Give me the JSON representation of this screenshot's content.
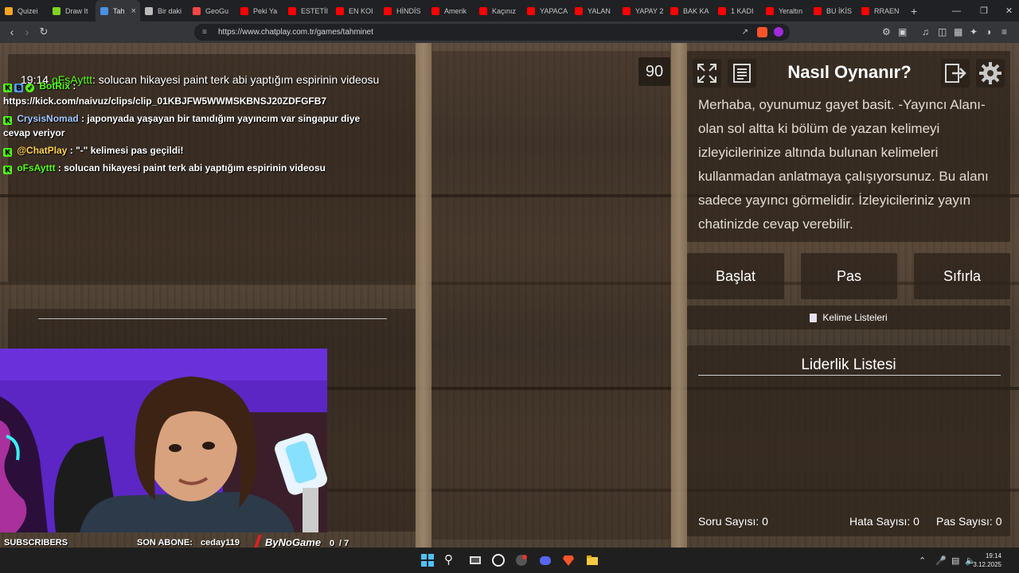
{
  "browser": {
    "tabs": [
      {
        "label": "Quizei",
        "color": "#f5a623"
      },
      {
        "label": "Draw It",
        "color": "#7ed321"
      },
      {
        "label": "Tah",
        "color": "#4a90e2",
        "active": true
      },
      {
        "label": "Bir daki",
        "color": "#bbbbbb"
      },
      {
        "label": "GeoGu",
        "color": "#ff4444"
      },
      {
        "label": "Peki Ya",
        "color": "#ff0000"
      },
      {
        "label": "ESTETİI",
        "color": "#ff0000"
      },
      {
        "label": "EN KOI",
        "color": "#ff0000"
      },
      {
        "label": "HİNDİS",
        "color": "#ff0000"
      },
      {
        "label": "Amerik",
        "color": "#ff0000"
      },
      {
        "label": "Kaçınız",
        "color": "#ff0000"
      },
      {
        "label": "YAPACA",
        "color": "#ff0000"
      },
      {
        "label": "YALAN",
        "color": "#ff0000"
      },
      {
        "label": "YAPAY 2",
        "color": "#ff0000"
      },
      {
        "label": "BAK KA",
        "color": "#ff0000"
      },
      {
        "label": "1 KADI",
        "color": "#ff0000"
      },
      {
        "label": "Yeraltın",
        "color": "#ff0000"
      },
      {
        "label": "BU İKİS",
        "color": "#ff0000"
      },
      {
        "label": "RRAEN",
        "color": "#ff0000"
      }
    ],
    "new_tab": "+",
    "url": "https://www.chatplay.com.tr/games/tahminet"
  },
  "chat": {
    "overlay": {
      "time": "19:14",
      "user": "oFsAyttt",
      "text": ": solucan hikayesi paint terk abi yaptığım espirinin videosu"
    },
    "messages": [
      {
        "user": "BotRix",
        "text": ":",
        "color": "green"
      },
      {
        "user": "",
        "text": "https://kick.com/naivuz/clips/clip_01KBJFW5WWMSKBNSJ20ZDFGFB7",
        "color": ""
      },
      {
        "user": "CrysisNomad",
        "text": ": japonyada yaşayan bir tanıdığım yayıncım var singapur diye",
        "color": "blue"
      },
      {
        "user": "",
        "text": "cevap veriyor",
        "color": ""
      },
      {
        "user": "@ChatPlay",
        "text": ": \"-\" kelimesi pas geçildi!",
        "color": "yellow"
      },
      {
        "user": "oFsAyttt",
        "text": ": solucan hikayesi paint terk abi yaptığım espirinin videosu",
        "color": "green"
      }
    ]
  },
  "game": {
    "timer": "90",
    "howto_title": "Nasıl Oynanır?",
    "howto_text": "Merhaba, oyunumuz gayet basit. -Yayıncı Alanı- olan sol altta ki bölüm de yazan kelimeyi izleyicilerinize altında bulunan kelimeleri kullanmadan anlatmaya çalışıyorsunuz. Bu alanı sadece yayıncı görmelidir. İzleyicileriniz yayın chatinizde cevap verebilir.",
    "buttons": {
      "start": "Başlat",
      "pass": "Pas",
      "reset": "Sıfırla"
    },
    "word_lists": "Kelime Listeleri",
    "leaderboard_title": "Liderlik Listesi",
    "stats": {
      "questions_label": "Soru Sayısı:",
      "questions": "0",
      "errors_label": "Hata Sayısı:",
      "errors": "0",
      "passes_label": "Pas Sayısı:",
      "passes": "0"
    }
  },
  "stream": {
    "subscribers_label": "SUBSCRIBERS",
    "last_sub_label": "SON ABONE:",
    "last_sub_name": "ceday119",
    "logo_text": "ByNoGame",
    "sub_goal_current": "0",
    "sub_goal_target": "/ 7",
    "sub_goal_progress": 0
  },
  "taskbar": {
    "time": "19:14",
    "date": "3.12.2025"
  }
}
